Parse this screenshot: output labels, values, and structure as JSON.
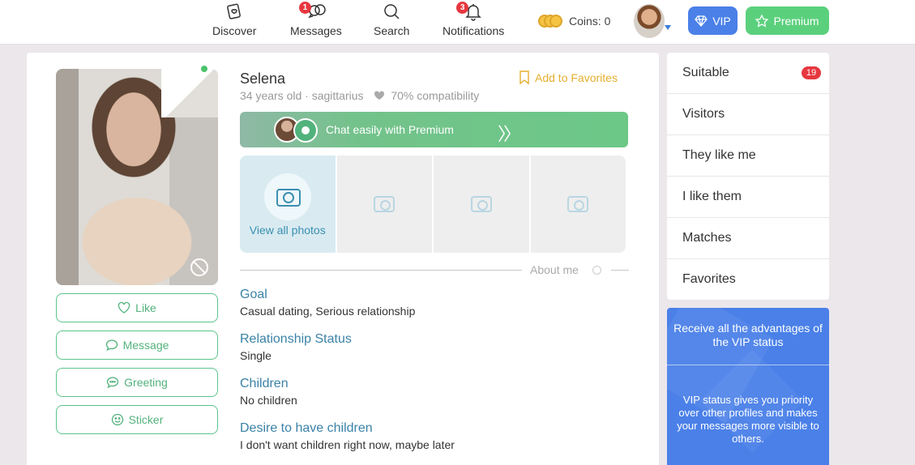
{
  "nav": {
    "discover": "Discover",
    "messages": "Messages",
    "messages_badge": "1",
    "search": "Search",
    "notifications": "Notifications",
    "notifications_badge": "3",
    "coins_label": "Coins: 0",
    "vip": "VIP",
    "premium": "Premium"
  },
  "profile": {
    "name": "Selena",
    "meta": "34 years old · sagittarius",
    "compatibility": "70% compatibility",
    "add_favorites": "Add to Favorites",
    "chat_banner": "Chat easily with Premium",
    "arrows": "〉〉",
    "view_all_photos": "View all photos",
    "about_me": "About me",
    "actions": {
      "like": "Like",
      "message": "Message",
      "greeting": "Greeting",
      "sticker": "Sticker"
    },
    "fields": [
      {
        "title": "Goal",
        "value": "Casual dating, Serious relationship"
      },
      {
        "title": "Relationship Status",
        "value": "Single"
      },
      {
        "title": "Children",
        "value": "No children"
      },
      {
        "title": "Desire to have children",
        "value": "I don't want children right now, maybe later"
      }
    ]
  },
  "sidebar": {
    "items": [
      {
        "label": "Suitable",
        "badge": "19"
      },
      {
        "label": "Visitors"
      },
      {
        "label": "They like me"
      },
      {
        "label": "I like them"
      },
      {
        "label": "Matches"
      },
      {
        "label": "Favorites"
      }
    ],
    "vip_promo": {
      "heading": "Receive all the advantages of the VIP status",
      "body": "VIP status gives you priority over other profiles and makes your messages more visible to others."
    }
  },
  "colors": {
    "accent_green": "#5bd07c",
    "vip_blue": "#4a80e8",
    "badge_red": "#e7373f",
    "link_blue": "#3a82a7",
    "favorite_gold": "#e5ae2d"
  }
}
